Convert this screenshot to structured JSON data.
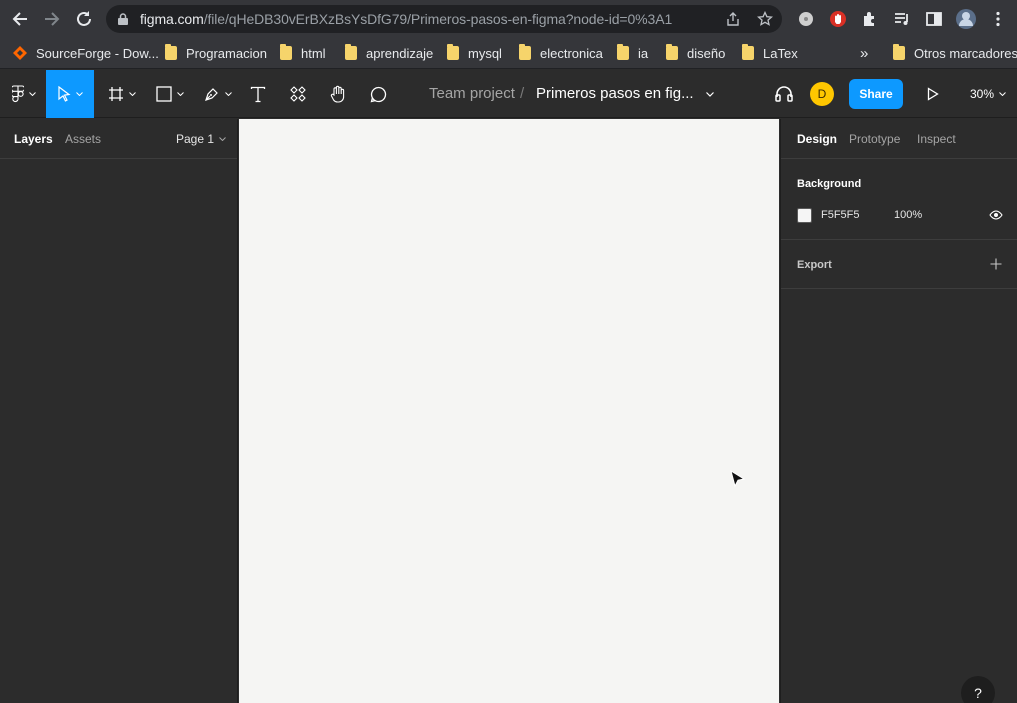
{
  "browser": {
    "url_main": "figma.com",
    "url_path": "/file/qHeDB30vErBXzBsYsDfG79/Primeros-pasos-en-figma?node-id=0%3A1",
    "bookmarks": [
      {
        "label": "SourceForge - Dow...",
        "icon": "sourceforge-icon"
      },
      {
        "label": "Programacion",
        "icon": "folder-icon"
      },
      {
        "label": "html",
        "icon": "folder-icon"
      },
      {
        "label": "aprendizaje",
        "icon": "folder-icon"
      },
      {
        "label": "mysql",
        "icon": "folder-icon"
      },
      {
        "label": "electronica",
        "icon": "folder-icon"
      },
      {
        "label": "ia",
        "icon": "folder-icon"
      },
      {
        "label": "diseño",
        "icon": "folder-icon"
      },
      {
        "label": "LaTex",
        "icon": "folder-icon"
      }
    ],
    "more_bookmarks": "»",
    "other_bookmarks": "Otros marcadores"
  },
  "toolbar": {
    "project": "Team project",
    "separator": "/",
    "file_name": "Primeros pasos en fig...",
    "avatar_initial": "D",
    "share_label": "Share",
    "zoom": "30%"
  },
  "left_panel": {
    "tabs": [
      "Layers",
      "Assets"
    ],
    "active_tab": "Layers",
    "page": "Page 1"
  },
  "right_panel": {
    "tabs": [
      "Design",
      "Prototype",
      "Inspect"
    ],
    "active_tab": "Design",
    "background_title": "Background",
    "background_hex": "F5F5F5",
    "background_opacity": "100%",
    "export_title": "Export"
  },
  "help": "?",
  "colors": {
    "accent": "#0d99ff",
    "canvas": "#f5f5f3",
    "panel": "#2c2c2c",
    "avatar": "#ffc700"
  }
}
